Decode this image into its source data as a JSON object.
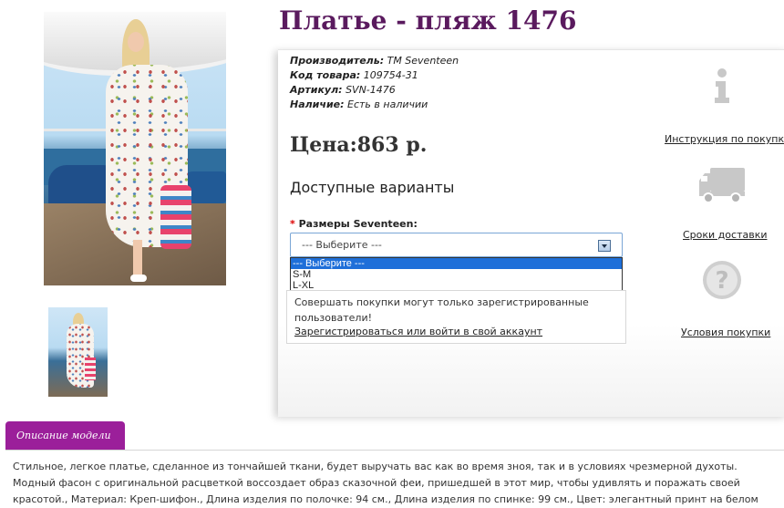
{
  "product": {
    "title": "Платье - пляж 1476",
    "meta": {
      "manufacturer_label": "Производитель:",
      "manufacturer_value": "TM Seventeen",
      "code_label": "Код товара:",
      "code_value": "109754-31",
      "article_label": "Артикул:",
      "article_value": "SVN-1476",
      "stock_label": "Наличие:",
      "stock_value": "Есть в наличии"
    },
    "price": "Цена:863 р.",
    "variants_heading": "Доступные варианты",
    "size_required_mark": "*",
    "size_label": "Размеры Seventeen:",
    "size_select": {
      "value": "--- Выберите ---",
      "options": [
        "--- Выберите ---",
        "S-M",
        "L-XL"
      ]
    },
    "notice": {
      "text": "Совершать покупки могут только зарегистрированные пользователи!",
      "link": "Зарегистрироваться или войти в свой аккаунт"
    }
  },
  "side": {
    "instruction_link": "Инструкция по покупке",
    "delivery_link": "Сроки доставки",
    "terms_link": "Условия покупки",
    "icons": [
      "info-icon",
      "truck-icon",
      "question-icon"
    ],
    "icon_color": "#c8c8c8"
  },
  "tabs": {
    "description_label": "Описание модели"
  },
  "description": "Стильное, легкое платье, сделанное из тончайшей ткани, будет выручать вас как во время зноя, так и в условиях чрезмерной духоты. Модный фасон с оригинальной расцветкой воссоздает образ сказочной феи, пришедшей в этот мир, чтобы удивлять и поражать своей красотой., Материал: Креп-шифон., Длина изделия по полочке: 94 см., Длина изделия по спинке: 99 см., Цвет: элегантный принт на белом фоне.",
  "colors": {
    "title": "#5a1a5e",
    "tab": "#9b1f9a",
    "select_highlight": "#1e6fd9"
  }
}
